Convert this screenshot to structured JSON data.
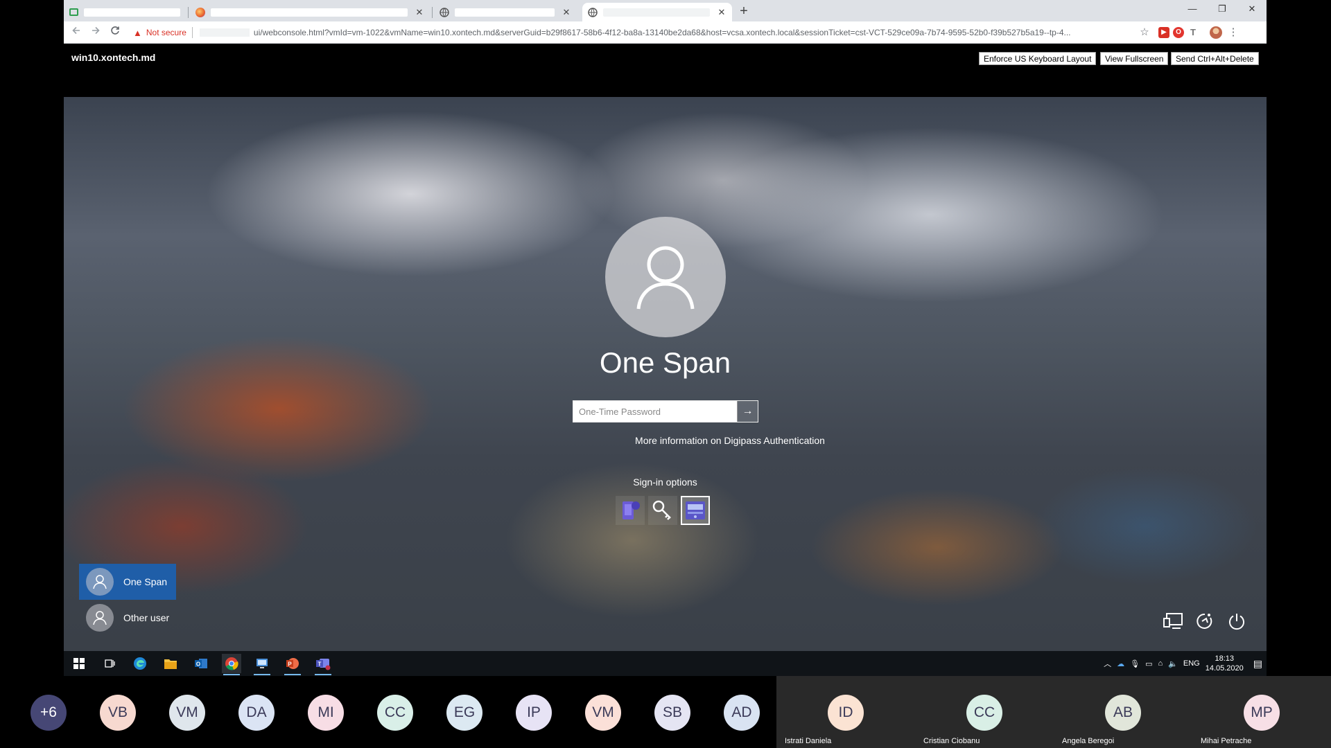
{
  "browser": {
    "tabs": [
      {
        "title": "",
        "active": false,
        "has_close": false
      },
      {
        "title": "",
        "active": false,
        "has_close": true
      },
      {
        "title": "",
        "active": false,
        "has_close": true
      },
      {
        "title": "",
        "active": true,
        "has_close": true
      }
    ],
    "close_glyph": "✕",
    "new_tab_glyph": "+",
    "window_controls": {
      "minimize": "—",
      "maximize": "❐",
      "close": "✕"
    },
    "security_label": "Not secure",
    "url": "ui/webconsole.html?vmId=vm-1022&vmName=win10.xontech.md&serverGuid=b29f8617-58b6-4f12-ba8a-13140be2da68&host=vcsa.xontech.local&sessionTicket=cst-VCT-529ce09a-7b74-9595-52b0-f39b527b5a19--tp-4..."
  },
  "console": {
    "vm_name": "win10.xontech.md",
    "buttons": {
      "keyboard": "Enforce US Keyboard Layout",
      "fullscreen": "View Fullscreen",
      "ctrl_alt_del": "Send Ctrl+Alt+Delete"
    }
  },
  "login": {
    "user_name": "One Span",
    "password_placeholder": "One-Time Password",
    "password_value": "",
    "submit_glyph": "→",
    "more_info": "More information on Digipass Authentication",
    "signin_options_label": "Sign-in options",
    "signin_options": [
      {
        "icon": "digipass-mobile-icon",
        "selected": false
      },
      {
        "icon": "key-icon",
        "selected": false
      },
      {
        "icon": "otp-token-icon",
        "selected": true
      }
    ],
    "users": [
      {
        "name": "One Span",
        "selected": true
      },
      {
        "name": "Other user",
        "selected": false
      }
    ]
  },
  "taskbar": {
    "apps": [
      "windows-start-icon",
      "task-view-icon",
      "edge-icon",
      "file-explorer-icon",
      "outlook-icon",
      "chrome-icon",
      "remote-desktop-icon",
      "powerpoint-icon",
      "teams-icon"
    ],
    "active_app": "chrome-icon",
    "language": "ENG",
    "time": "18:13",
    "date": "14.05.2020"
  },
  "meeting": {
    "overflow_count": "+6",
    "overflow_color": "#464775",
    "avatars": [
      {
        "initials": "VB",
        "color": "#f7d9d0"
      },
      {
        "initials": "VM",
        "color": "#dfe6ec"
      },
      {
        "initials": "DA",
        "color": "#dbe4f4"
      },
      {
        "initials": "MI",
        "color": "#f7dde5"
      },
      {
        "initials": "CC",
        "color": "#d9efe8"
      },
      {
        "initials": "EG",
        "color": "#dce9f2"
      },
      {
        "initials": "IP",
        "color": "#e7e3f5"
      },
      {
        "initials": "VM",
        "color": "#fbe0d8"
      },
      {
        "initials": "SB",
        "color": "#e5e5f3"
      },
      {
        "initials": "AD",
        "color": "#d9e3f2"
      }
    ],
    "tiles": [
      {
        "initials": "ID",
        "name": "Istrati Daniela",
        "color": "#fbe3d3"
      },
      {
        "initials": "CC",
        "name": "Cristian Ciobanu",
        "color": "#d9efe6"
      },
      {
        "initials": "AB",
        "name": "Angela Beregoi",
        "color": "#e1e6da"
      },
      {
        "initials": "MP",
        "name": "Mihai Petrache",
        "color": "#f7dfe6"
      }
    ]
  }
}
